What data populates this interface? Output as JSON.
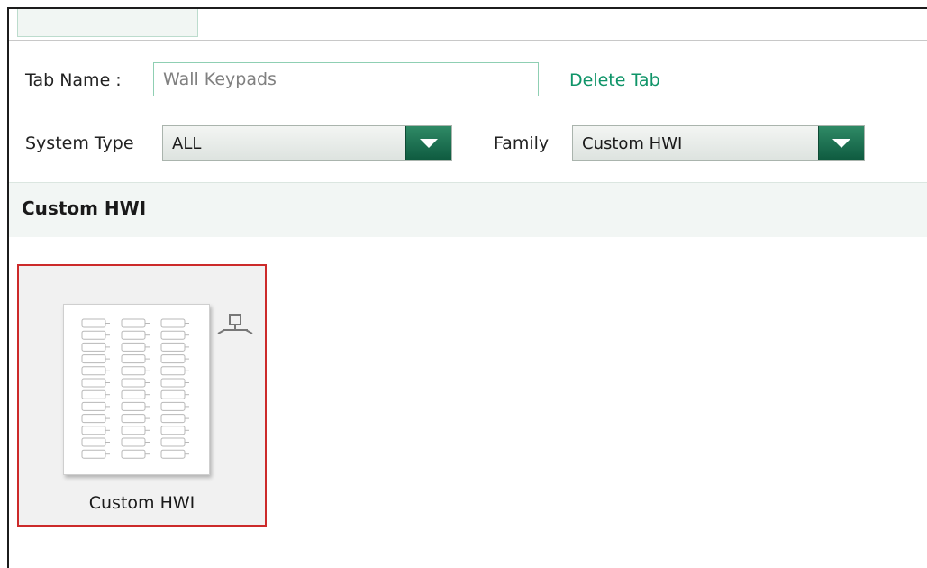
{
  "tab_form": {
    "tab_name_label": "Tab Name :",
    "tab_name_value": "Wall Keypads",
    "delete_tab_label": "Delete Tab"
  },
  "filters": {
    "system_type_label": "System Type",
    "system_type_value": "ALL",
    "family_label": "Family",
    "family_value": "Custom HWI"
  },
  "section": {
    "title": "Custom HWI"
  },
  "devices": [
    {
      "label": "Custom HWI",
      "icon": "keypad-icon",
      "selected": true,
      "badge_icon": "network-link-icon"
    }
  ],
  "colors": {
    "accent": "#0f9468",
    "dropdown_button": "#1f7552",
    "selection_border": "#cc2a2a"
  }
}
